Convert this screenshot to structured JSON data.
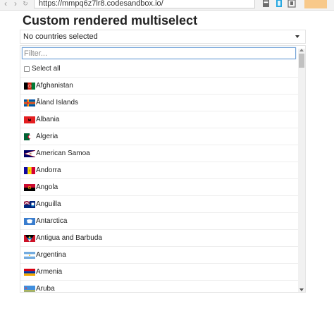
{
  "browser": {
    "url": "https://mmpq6z7lr8.codesandbox.io/",
    "back_glyph": "‹",
    "forward_glyph": "›"
  },
  "page": {
    "title": "Custom rendered multiselect"
  },
  "select": {
    "placeholder_text": "No countries selected"
  },
  "filter": {
    "placeholder": "Filter...",
    "value": ""
  },
  "select_all_label": "Select all",
  "countries": [
    {
      "name": "Afghanistan",
      "flag": "afghanistan-flag-icon"
    },
    {
      "name": "Åland Islands",
      "flag": "aland-islands-flag-icon"
    },
    {
      "name": "Albania",
      "flag": "albania-flag-icon"
    },
    {
      "name": "Algeria",
      "flag": "algeria-flag-icon"
    },
    {
      "name": "American Samoa",
      "flag": "american-samoa-flag-icon"
    },
    {
      "name": "Andorra",
      "flag": "andorra-flag-icon"
    },
    {
      "name": "Angola",
      "flag": "angola-flag-icon"
    },
    {
      "name": "Anguilla",
      "flag": "anguilla-flag-icon"
    },
    {
      "name": "Antarctica",
      "flag": "antarctica-flag-icon"
    },
    {
      "name": "Antigua and Barbuda",
      "flag": "antigua-and-barbuda-flag-icon"
    },
    {
      "name": "Argentina",
      "flag": "argentina-flag-icon"
    },
    {
      "name": "Armenia",
      "flag": "armenia-flag-icon"
    },
    {
      "name": "Aruba",
      "flag": "aruba-flag-icon"
    }
  ],
  "colors": {
    "accent_focus": "#7aa7d9",
    "border": "#e3e3e3",
    "text": "#222222"
  }
}
